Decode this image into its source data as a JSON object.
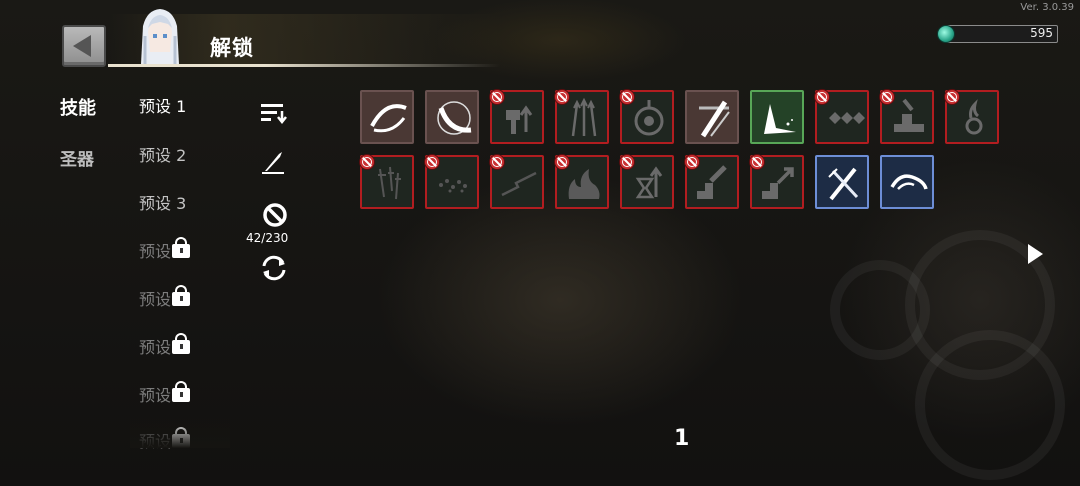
{
  "version": "Ver. 3.0.39",
  "header": {
    "title": "解锁"
  },
  "currency": {
    "value": "595",
    "icon": "gem-icon"
  },
  "categories": [
    {
      "label": "技能",
      "active": true
    },
    {
      "label": "圣器",
      "active": false
    }
  ],
  "presets": [
    {
      "label": "预设 1",
      "locked": false,
      "selected": true
    },
    {
      "label": "预设 2",
      "locked": false,
      "selected": false
    },
    {
      "label": "预设 3",
      "locked": false,
      "selected": false
    },
    {
      "label": "预设",
      "locked": true
    },
    {
      "label": "预设",
      "locked": true
    },
    {
      "label": "预设",
      "locked": true
    },
    {
      "label": "预设",
      "locked": true
    },
    {
      "label": "预设",
      "locked": true
    }
  ],
  "tools": {
    "sort_icon": "sort-icon",
    "edit_icon": "edit-icon",
    "filter_icon": "prohibit-icon",
    "count": "42/230",
    "refresh_icon": "refresh-icon"
  },
  "skill_grid": {
    "row1": [
      {
        "icon": "slash-orbit",
        "state": "owned"
      },
      {
        "icon": "crescent-slash",
        "state": "owned"
      },
      {
        "icon": "hammer-arrow",
        "state": "locked"
      },
      {
        "icon": "triple-arrows",
        "state": "locked"
      },
      {
        "icon": "target-ring",
        "state": "locked"
      },
      {
        "icon": "cross-slash",
        "state": "owned"
      },
      {
        "icon": "ground-burst",
        "state": "green"
      },
      {
        "icon": "shuriken-chain",
        "state": "locked"
      },
      {
        "icon": "anvil-strike",
        "state": "locked"
      },
      {
        "icon": "flame-orb",
        "state": "locked"
      }
    ],
    "row2": [
      {
        "icon": "falling-swords",
        "state": "locked"
      },
      {
        "icon": "scatter-dust",
        "state": "locked"
      },
      {
        "icon": "lightning-streak",
        "state": "locked"
      },
      {
        "icon": "fire-wave",
        "state": "locked"
      },
      {
        "icon": "hourglass-arrow",
        "state": "locked"
      },
      {
        "icon": "stair-strike",
        "state": "locked"
      },
      {
        "icon": "stair-arrow",
        "state": "locked"
      },
      {
        "icon": "crossed-blades",
        "state": "blue"
      },
      {
        "icon": "swirl-wave",
        "state": "blue"
      }
    ]
  },
  "pagination": {
    "current": "1"
  },
  "colors": {
    "locked_border": "#b21d20",
    "owned_bg": "#4a3834",
    "green_border": "#58a657",
    "blue_border": "#6d8ed6"
  }
}
